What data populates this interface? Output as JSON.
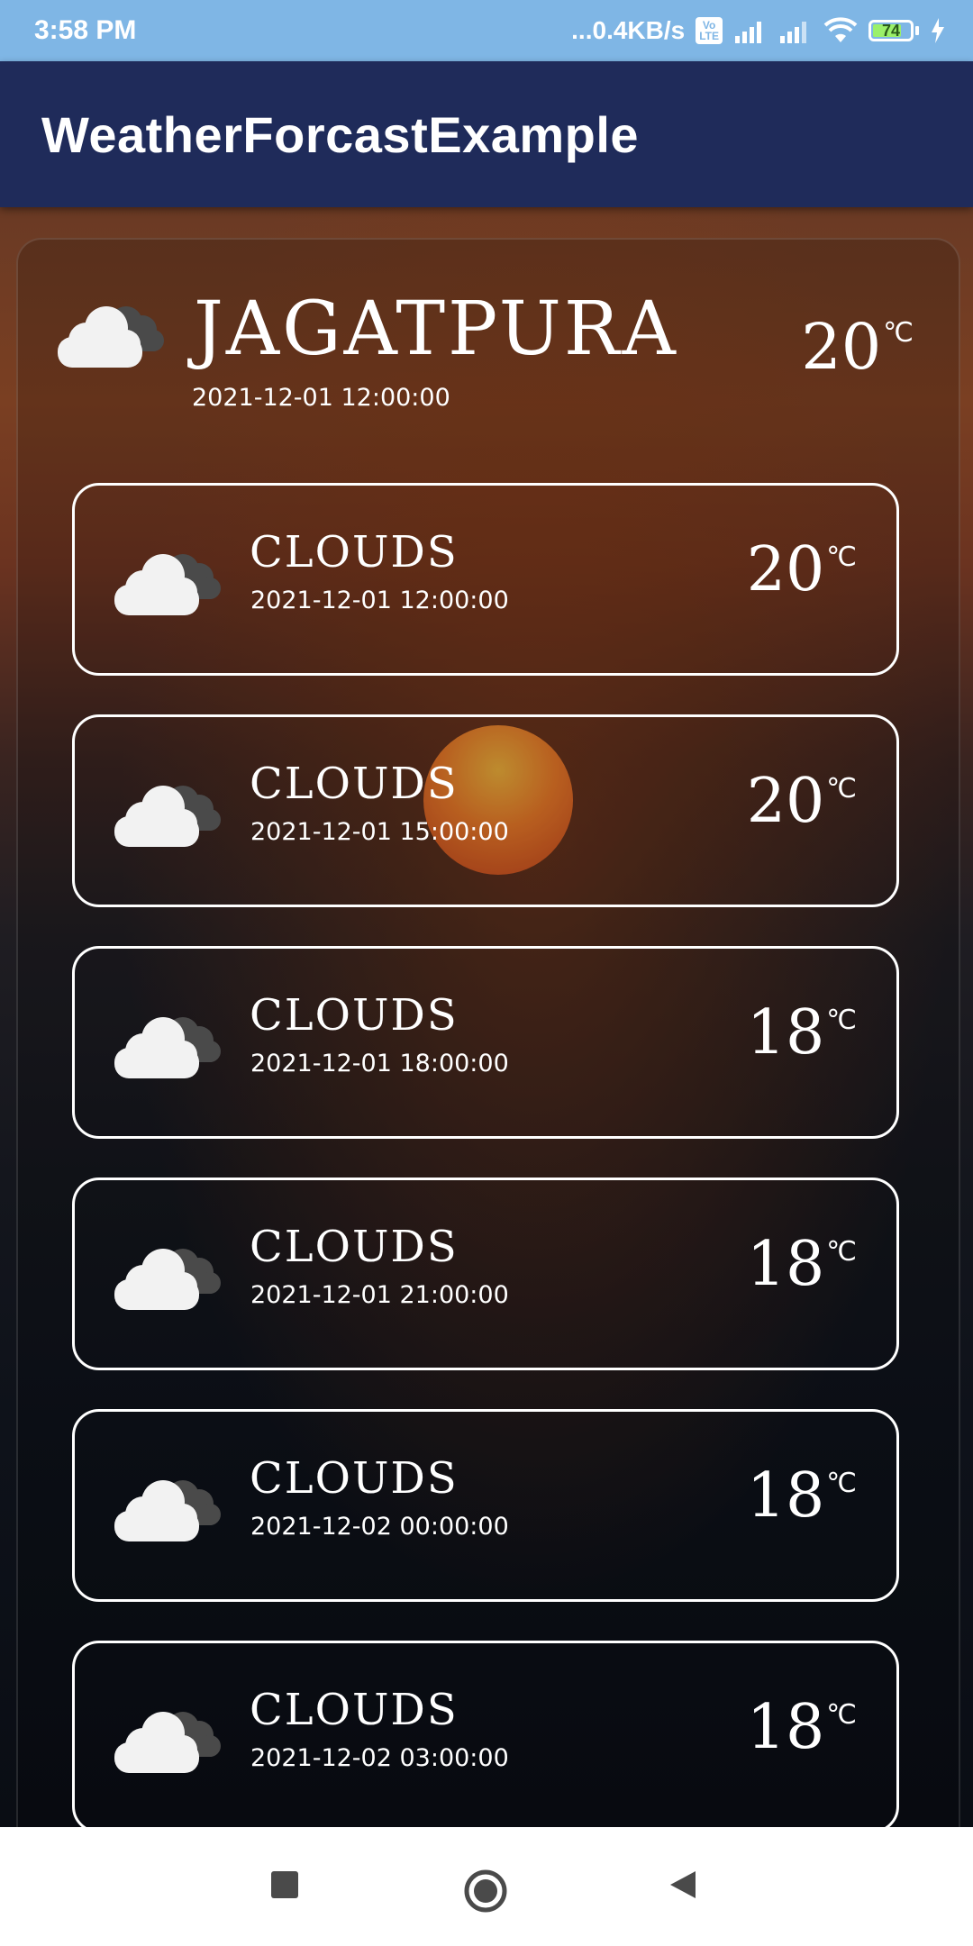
{
  "status_bar": {
    "time": "3:58 PM",
    "network_speed": "...0.4KB/s",
    "volte": "Vo\nLTE",
    "battery": "74",
    "icons": [
      "signal-icon",
      "signal-icon",
      "wifi-icon",
      "battery-icon",
      "charging-icon"
    ]
  },
  "app_bar": {
    "title": "WeatherForcastExample"
  },
  "header": {
    "city": "JAGATPURA",
    "date": "2021-12-01 12:00:00",
    "temp": "20",
    "unit": "℃",
    "icon": "cloud-icon"
  },
  "forecast": [
    {
      "condition": "CLOUDS",
      "date": "2021-12-01 12:00:00",
      "temp": "20",
      "unit": "℃",
      "icon": "cloud-icon"
    },
    {
      "condition": "CLOUDS",
      "date": "2021-12-01 15:00:00",
      "temp": "20",
      "unit": "℃",
      "icon": "cloud-icon"
    },
    {
      "condition": "CLOUDS",
      "date": "2021-12-01 18:00:00",
      "temp": "18",
      "unit": "℃",
      "icon": "cloud-icon"
    },
    {
      "condition": "CLOUDS",
      "date": "2021-12-01 21:00:00",
      "temp": "18",
      "unit": "℃",
      "icon": "cloud-icon"
    },
    {
      "condition": "CLOUDS",
      "date": "2021-12-02 00:00:00",
      "temp": "18",
      "unit": "℃",
      "icon": "cloud-icon"
    },
    {
      "condition": "CLOUDS",
      "date": "2021-12-02 03:00:00",
      "temp": "18",
      "unit": "℃",
      "icon": "cloud-icon"
    }
  ],
  "nav_bar": {
    "buttons": [
      "recents-icon",
      "home-icon",
      "back-icon"
    ]
  },
  "colors": {
    "status_bar": "#7fb6e5",
    "app_bar": "#1f2b5a",
    "card_border": "#ffffff"
  }
}
